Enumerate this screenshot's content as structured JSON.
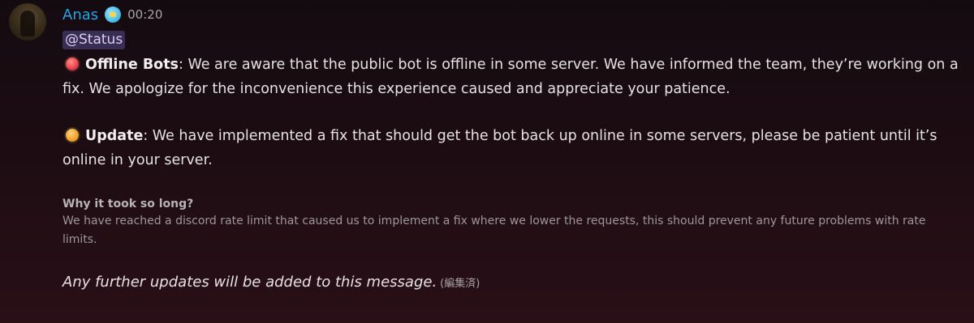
{
  "message": {
    "author": "Anas",
    "timestamp": "00:20",
    "mention": "@Status",
    "offline": {
      "title": "Offline Bots",
      "text": ": We are aware that the public bot is offline in some server. We have informed the team, they’re working on a fix. We apologize for the inconvenience this experience caused and appreciate your patience."
    },
    "update": {
      "title": "Update",
      "text": ": We have implemented a fix that should get the bot back up online in some servers, please be patient until it’s online in your server."
    },
    "why": {
      "heading": "Why it took so long?",
      "text": "We have reached a discord rate limit that caused us to implement a fix where we lower the requests, this should prevent any future problems with rate limits."
    },
    "footer": "Any further updates will be added to this message.",
    "edited": "(編集済)"
  },
  "colors": {
    "username": "#28a3e6",
    "mention_bg": "#3a2d54",
    "offline_dot": "#e8454c",
    "update_dot": "#f7a531"
  },
  "icons": {
    "offline": "red-circle-icon",
    "update": "orange-circle-icon",
    "badge": "bird-badge-icon"
  }
}
